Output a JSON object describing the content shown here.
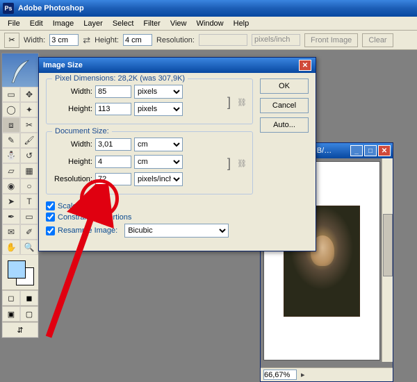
{
  "app": {
    "title": "Adobe Photoshop"
  },
  "menu": {
    "items": [
      "File",
      "Edit",
      "Image",
      "Layer",
      "Select",
      "Filter",
      "View",
      "Window",
      "Help"
    ]
  },
  "options": {
    "width_label": "Width:",
    "width_value": "3 cm",
    "height_label": "Height:",
    "height_value": "4 cm",
    "resolution_label": "Resolution:",
    "resolution_value": "",
    "resolution_unit": "pixels/inch",
    "front_image": "Front Image",
    "clear": "Clear"
  },
  "dialog": {
    "title": "Image Size",
    "pixel_dim_label": "Pixel Dimensions:",
    "pixel_dim_value": "28,2K (was 307,9K)",
    "px_width_label": "Width:",
    "px_width_value": "85",
    "px_height_label": "Height:",
    "px_height_value": "113",
    "px_unit": "pixels",
    "doc_label": "Document Size:",
    "doc_width_label": "Width:",
    "doc_width_value": "3,01",
    "doc_height_label": "Height:",
    "doc_height_value": "4",
    "doc_unit": "cm",
    "res_label": "Resolution:",
    "res_value": "72",
    "res_unit": "pixels/inch",
    "scale_styles": "Scale Styles",
    "constrain": "Constrain Proportions",
    "resample": "Resample Image:",
    "resample_method": "Bicubic",
    "ok": "OK",
    "cancel": "Cancel",
    "auto": "Auto..."
  },
  "image_window": {
    "title": "g @ 66,7% (RGB/…",
    "zoom": "66,67%"
  }
}
